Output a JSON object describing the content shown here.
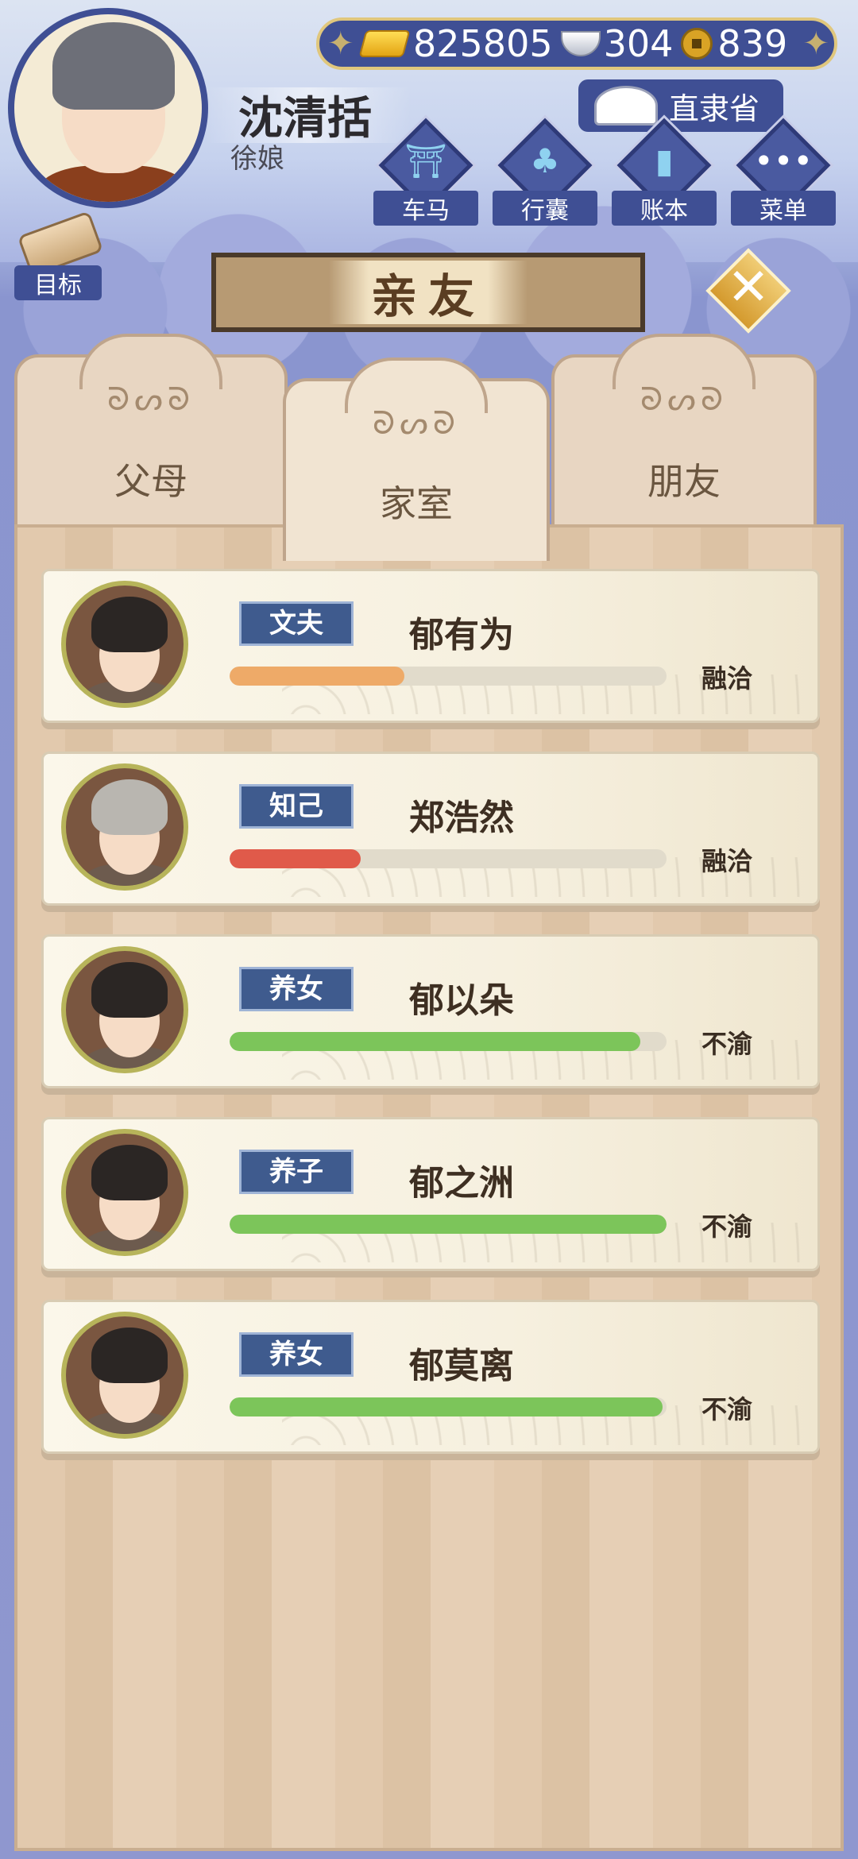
{
  "currencies": {
    "gold": "825805",
    "silver": "304",
    "coin": "839"
  },
  "player": {
    "name": "沈清括",
    "title": "徐娘",
    "province": "直隶省"
  },
  "nav": [
    {
      "label": "车马",
      "icon": "carriage-icon"
    },
    {
      "label": "行囊",
      "icon": "bag-icon"
    },
    {
      "label": "账本",
      "icon": "ledger-icon"
    },
    {
      "label": "菜单",
      "icon": "menu-icon"
    }
  ],
  "goal": {
    "label": "目标"
  },
  "page_title": "亲友",
  "tabs": [
    {
      "label": "父母",
      "selected": false
    },
    {
      "label": "家室",
      "selected": true
    },
    {
      "label": "朋友",
      "selected": false
    }
  ],
  "members": [
    {
      "role": "文夫",
      "name": "郁有为",
      "status": "融洽",
      "relation_level": 0.4,
      "bar_color": "#eeaa68",
      "hair": "dark"
    },
    {
      "role": "知己",
      "name": "郑浩然",
      "status": "融洽",
      "relation_level": 0.3,
      "bar_color": "#e05a4a",
      "hair": "gray"
    },
    {
      "role": "养女",
      "name": "郁以朵",
      "status": "不渝",
      "relation_level": 0.94,
      "bar_color": "#7cc55a",
      "hair": "dark"
    },
    {
      "role": "养子",
      "name": "郁之洲",
      "status": "不渝",
      "relation_level": 1.0,
      "bar_color": "#7cc55a",
      "hair": "dark"
    },
    {
      "role": "养女",
      "name": "郁莫离",
      "status": "不渝",
      "relation_level": 0.99,
      "bar_color": "#7cc55a",
      "hair": "dark"
    }
  ]
}
